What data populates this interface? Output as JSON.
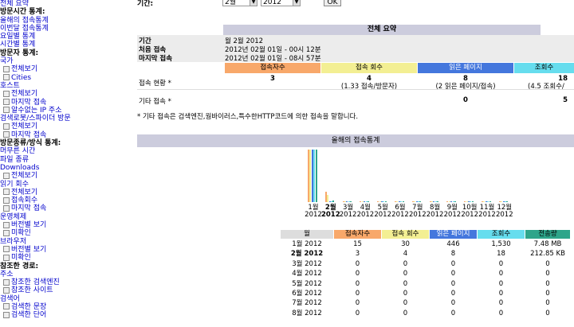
{
  "menu": [
    {
      "t": "link",
      "text": "전체 요약"
    },
    {
      "t": "head",
      "text": "방문시간 통계:"
    },
    {
      "t": "link",
      "text": "올해의 접속통계"
    },
    {
      "t": "link",
      "text": "이번달 접속통계"
    },
    {
      "t": "link",
      "text": "요일별 통계"
    },
    {
      "t": "link",
      "text": "시간별 통계"
    },
    {
      "t": "head",
      "text": "방문자 통계:"
    },
    {
      "t": "sub",
      "text": "국가"
    },
    {
      "t": "item",
      "text": "전체보기"
    },
    {
      "t": "item",
      "text": "Cities"
    },
    {
      "t": "sub",
      "text": "호스트"
    },
    {
      "t": "item",
      "text": "전체보기"
    },
    {
      "t": "item",
      "text": "마지막 접속"
    },
    {
      "t": "item",
      "text": "알수없는 IP 주소"
    },
    {
      "t": "sub",
      "text": "검색로봇/스파이더 방문"
    },
    {
      "t": "item",
      "text": "전체보기"
    },
    {
      "t": "item",
      "text": "마지막 접속"
    },
    {
      "t": "head",
      "text": "방문종류/방식 통계:"
    },
    {
      "t": "link",
      "text": "머무른 시간"
    },
    {
      "t": "link",
      "text": "파일 종류"
    },
    {
      "t": "sub",
      "text": "Downloads"
    },
    {
      "t": "item",
      "text": "전체보기"
    },
    {
      "t": "sub",
      "text": "읽기 회수"
    },
    {
      "t": "item",
      "text": "전체보기"
    },
    {
      "t": "item",
      "text": "접속회수"
    },
    {
      "t": "item",
      "text": "마지막 접속"
    },
    {
      "t": "sub",
      "text": "운영체제"
    },
    {
      "t": "item",
      "text": "버전별 보기"
    },
    {
      "t": "item",
      "text": "미확인"
    },
    {
      "t": "sub",
      "text": "브라우저"
    },
    {
      "t": "item",
      "text": "버전별 보기"
    },
    {
      "t": "item",
      "text": "미확인"
    },
    {
      "t": "head",
      "text": "참조한 경로:"
    },
    {
      "t": "sub",
      "text": "주소"
    },
    {
      "t": "item",
      "text": "참조한 검색엔진"
    },
    {
      "t": "item",
      "text": "참조한 사이트"
    },
    {
      "t": "sub",
      "text": "검색어"
    },
    {
      "t": "item",
      "text": "검색한 문장"
    },
    {
      "t": "item",
      "text": "검색한 단어"
    }
  ],
  "topbar": {
    "label": "기간:",
    "month": "2월",
    "year": "2012",
    "ok": "OK"
  },
  "summary": {
    "title": "전체 요약",
    "period_k": "기간",
    "period_v": "월 2월 2012",
    "first_k": "처음 접속",
    "first_v": "2012년 02월 01일 - 00시 12분",
    "last_k": "마지막 접속",
    "last_v": "2012년 02월 01일 - 08시 57분",
    "cols": [
      "접속자수",
      "접속 회수",
      "읽은 페이지",
      "조회수"
    ],
    "row1_k": "접속 현황 *",
    "row1": [
      "3",
      "4",
      "8",
      "18"
    ],
    "row1_sub": [
      "",
      "(1.33 접속/방문자)",
      "(2 읽은 페이지/접속)",
      "(4.5 조회수/"
    ],
    "row2_k": "기타 접속 *",
    "row2": [
      "",
      "",
      "0",
      "5"
    ],
    "note": "* 기타 접속은 검색엔진,웜바이러스,특수한HTTP코드에 의한 접속을 말합니다."
  },
  "yearly": {
    "title": "올해의 접속통계",
    "months": [
      "1월",
      "2월",
      "3월",
      "4월",
      "5월",
      "6월",
      "7월",
      "8월",
      "9월",
      "10월",
      "11월",
      "12월"
    ],
    "year": "2012",
    "table_head": [
      "월",
      "접속자수",
      "접속 회수",
      "읽은 페이지",
      "조회수",
      "전송량"
    ],
    "rows": [
      [
        "1월 2012",
        "15",
        "30",
        "446",
        "1,530",
        "7.48 MB"
      ],
      [
        "2월 2012",
        "3",
        "4",
        "8",
        "18",
        "212.85 KB"
      ],
      [
        "3월 2012",
        "0",
        "0",
        "0",
        "0",
        "0"
      ],
      [
        "4월 2012",
        "0",
        "0",
        "0",
        "0",
        "0"
      ],
      [
        "5월 2012",
        "0",
        "0",
        "0",
        "0",
        "0"
      ],
      [
        "6월 2012",
        "0",
        "0",
        "0",
        "0",
        "0"
      ],
      [
        "7월 2012",
        "0",
        "0",
        "0",
        "0",
        "0"
      ],
      [
        "8월 2012",
        "0",
        "0",
        "0",
        "0",
        "0"
      ]
    ]
  },
  "colors": {
    "visitors": "#f8a86a",
    "visits": "#f3ef93",
    "pages": "#4477dd",
    "hits": "#66ddee",
    "bandwidth": "#2ea58a",
    "band": "#ccccdd"
  },
  "chart_data": {
    "type": "bar",
    "categories": [
      "1월",
      "2월",
      "3월",
      "4월",
      "5월",
      "6월",
      "7월",
      "8월",
      "9월",
      "10월",
      "11월",
      "12월"
    ],
    "series": [
      {
        "name": "접속자수",
        "values": [
          15,
          3,
          0,
          0,
          0,
          0,
          0,
          0,
          0,
          0,
          0,
          0
        ]
      },
      {
        "name": "접속 회수",
        "values": [
          30,
          4,
          0,
          0,
          0,
          0,
          0,
          0,
          0,
          0,
          0,
          0
        ]
      },
      {
        "name": "읽은 페이지",
        "values": [
          446,
          8,
          0,
          0,
          0,
          0,
          0,
          0,
          0,
          0,
          0,
          0
        ]
      },
      {
        "name": "조회수",
        "values": [
          1530,
          18,
          0,
          0,
          0,
          0,
          0,
          0,
          0,
          0,
          0,
          0
        ]
      },
      {
        "name": "전송량",
        "values": [
          7.48,
          0.21,
          0,
          0,
          0,
          0,
          0,
          0,
          0,
          0,
          0,
          0
        ]
      }
    ]
  }
}
